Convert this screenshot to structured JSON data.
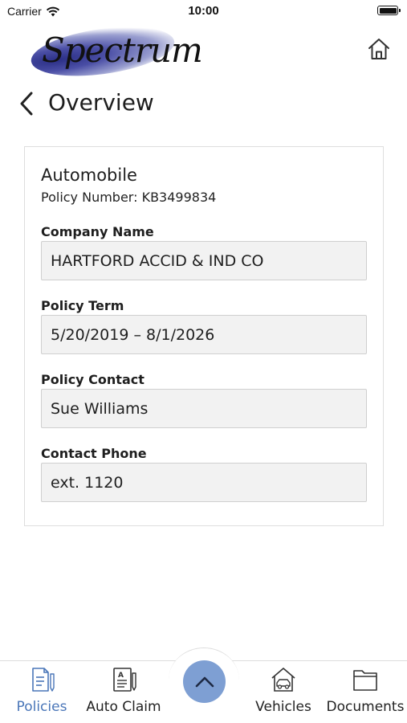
{
  "status_bar": {
    "carrier": "Carrier",
    "time": "10:00"
  },
  "header": {
    "logo_text": "Spectrum",
    "home_icon": "home-icon"
  },
  "page": {
    "title": "Overview",
    "back_icon": "chevron-left-icon"
  },
  "policy": {
    "type": "Automobile",
    "number_line": "Policy Number: KB3499834",
    "fields": [
      {
        "label": "Company Name",
        "value": "HARTFORD ACCID & IND CO"
      },
      {
        "label": "Policy Term",
        "value": "5/20/2019 – 8/1/2026"
      },
      {
        "label": "Policy Contact",
        "value": "Sue Williams"
      },
      {
        "label": "Contact Phone",
        "value": "ext. 1120"
      }
    ]
  },
  "tab_bar": {
    "tabs": [
      {
        "label": "Policies",
        "icon": "policies-icon",
        "active": true
      },
      {
        "label": "Auto Claim",
        "icon": "auto-claim-icon",
        "active": false
      },
      {
        "label": "Vehicles",
        "icon": "vehicles-icon",
        "active": false
      },
      {
        "label": "Documents",
        "icon": "documents-icon",
        "active": false
      }
    ],
    "center_button_icon": "chevron-up-icon"
  },
  "colors": {
    "accent": "#4a76b8",
    "fab": "#7e9fd3",
    "field_bg": "#f2f2f2",
    "border": "#dedede"
  }
}
